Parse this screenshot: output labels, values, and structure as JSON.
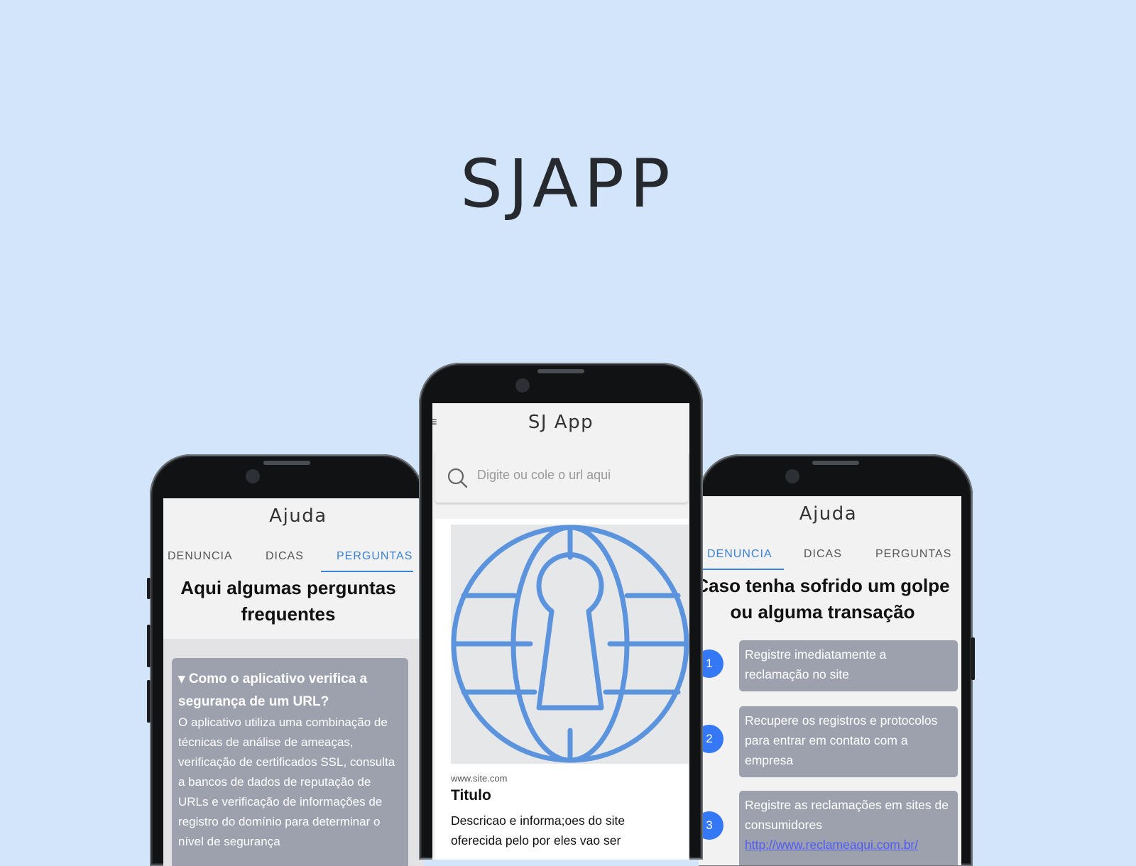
{
  "hero": {
    "title": "SJAPP"
  },
  "left_phone": {
    "title": "Ajuda",
    "tabs": [
      "DENUNCIA",
      "DICAS",
      "PERGUNTAS"
    ],
    "active_tab": "PERGUNTAS",
    "heading": "Aqui algumas perguntas frequentes",
    "faq": {
      "question": "▾ Como o aplicativo verifica a segurança de um URL?",
      "answer": "O aplicativo utiliza uma combinação de técnicas de análise de ameaças, verificação de certificados SSL, consulta a bancos de dados de reputação de URLs e verificação de informações de registro do domínio para determinar o nível de segurança"
    }
  },
  "center_phone": {
    "title": "SJ App",
    "search": {
      "placeholder": "Digite ou cole o url aqui",
      "value": ""
    },
    "result": {
      "image_icon": "globe-keyhole-icon",
      "url": "www.site.com",
      "title": "Titulo",
      "description": "Descricao e informa;oes do site oferecida pelo por eles vao ser"
    }
  },
  "right_phone": {
    "title": "Ajuda",
    "tabs": [
      "DENUNCIA",
      "DICAS",
      "PERGUNTAS"
    ],
    "active_tab": "DENUNCIA",
    "heading": "Caso tenha sofrido um golpe ou alguma transação",
    "steps": [
      {
        "number": "1",
        "text": "Registre imediatamente a reclamação no site"
      },
      {
        "number": "2",
        "text": "Recupere os registros e protocolos para entrar em contato com a empresa"
      },
      {
        "number": "3",
        "text": "Registre as reclamações em sites de consumidores",
        "link": "http://www.reclameaqui.com.br/"
      }
    ]
  },
  "colors": {
    "background": "#d2e5fb",
    "accent": "#3b82d6",
    "card": "#9da1ad",
    "step_circle": "#3478f6",
    "globe_icon": "#5b93dc"
  }
}
